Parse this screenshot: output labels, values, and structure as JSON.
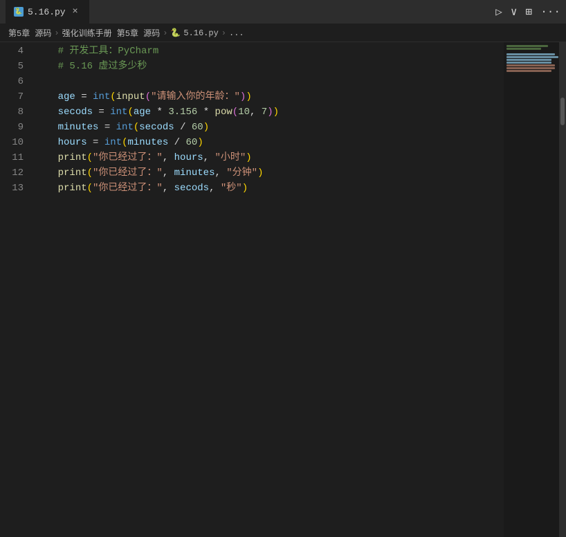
{
  "titlebar": {
    "tab_icon": "🐍",
    "tab_name": "5.16.py",
    "tab_close": "×",
    "run_icon": "▷",
    "dropdown_icon": "∨",
    "split_icon": "⊞",
    "more_icon": "···"
  },
  "breadcrumb": {
    "items": [
      "第5章 源码",
      "强化训练手册 第5章 源码",
      "🐍 5.16.py",
      "..."
    ]
  },
  "lines": [
    {
      "num": "4",
      "code": "comment_pycharm"
    },
    {
      "num": "5",
      "code": "comment_5_16"
    },
    {
      "num": "6",
      "code": "blank"
    },
    {
      "num": "7",
      "code": "age_assignment"
    },
    {
      "num": "8",
      "code": "secods_assignment"
    },
    {
      "num": "9",
      "code": "minutes_assignment"
    },
    {
      "num": "10",
      "code": "hours_assignment"
    },
    {
      "num": "11",
      "code": "print_hours"
    },
    {
      "num": "12",
      "code": "print_minutes"
    },
    {
      "num": "13",
      "code": "print_secods"
    }
  ]
}
